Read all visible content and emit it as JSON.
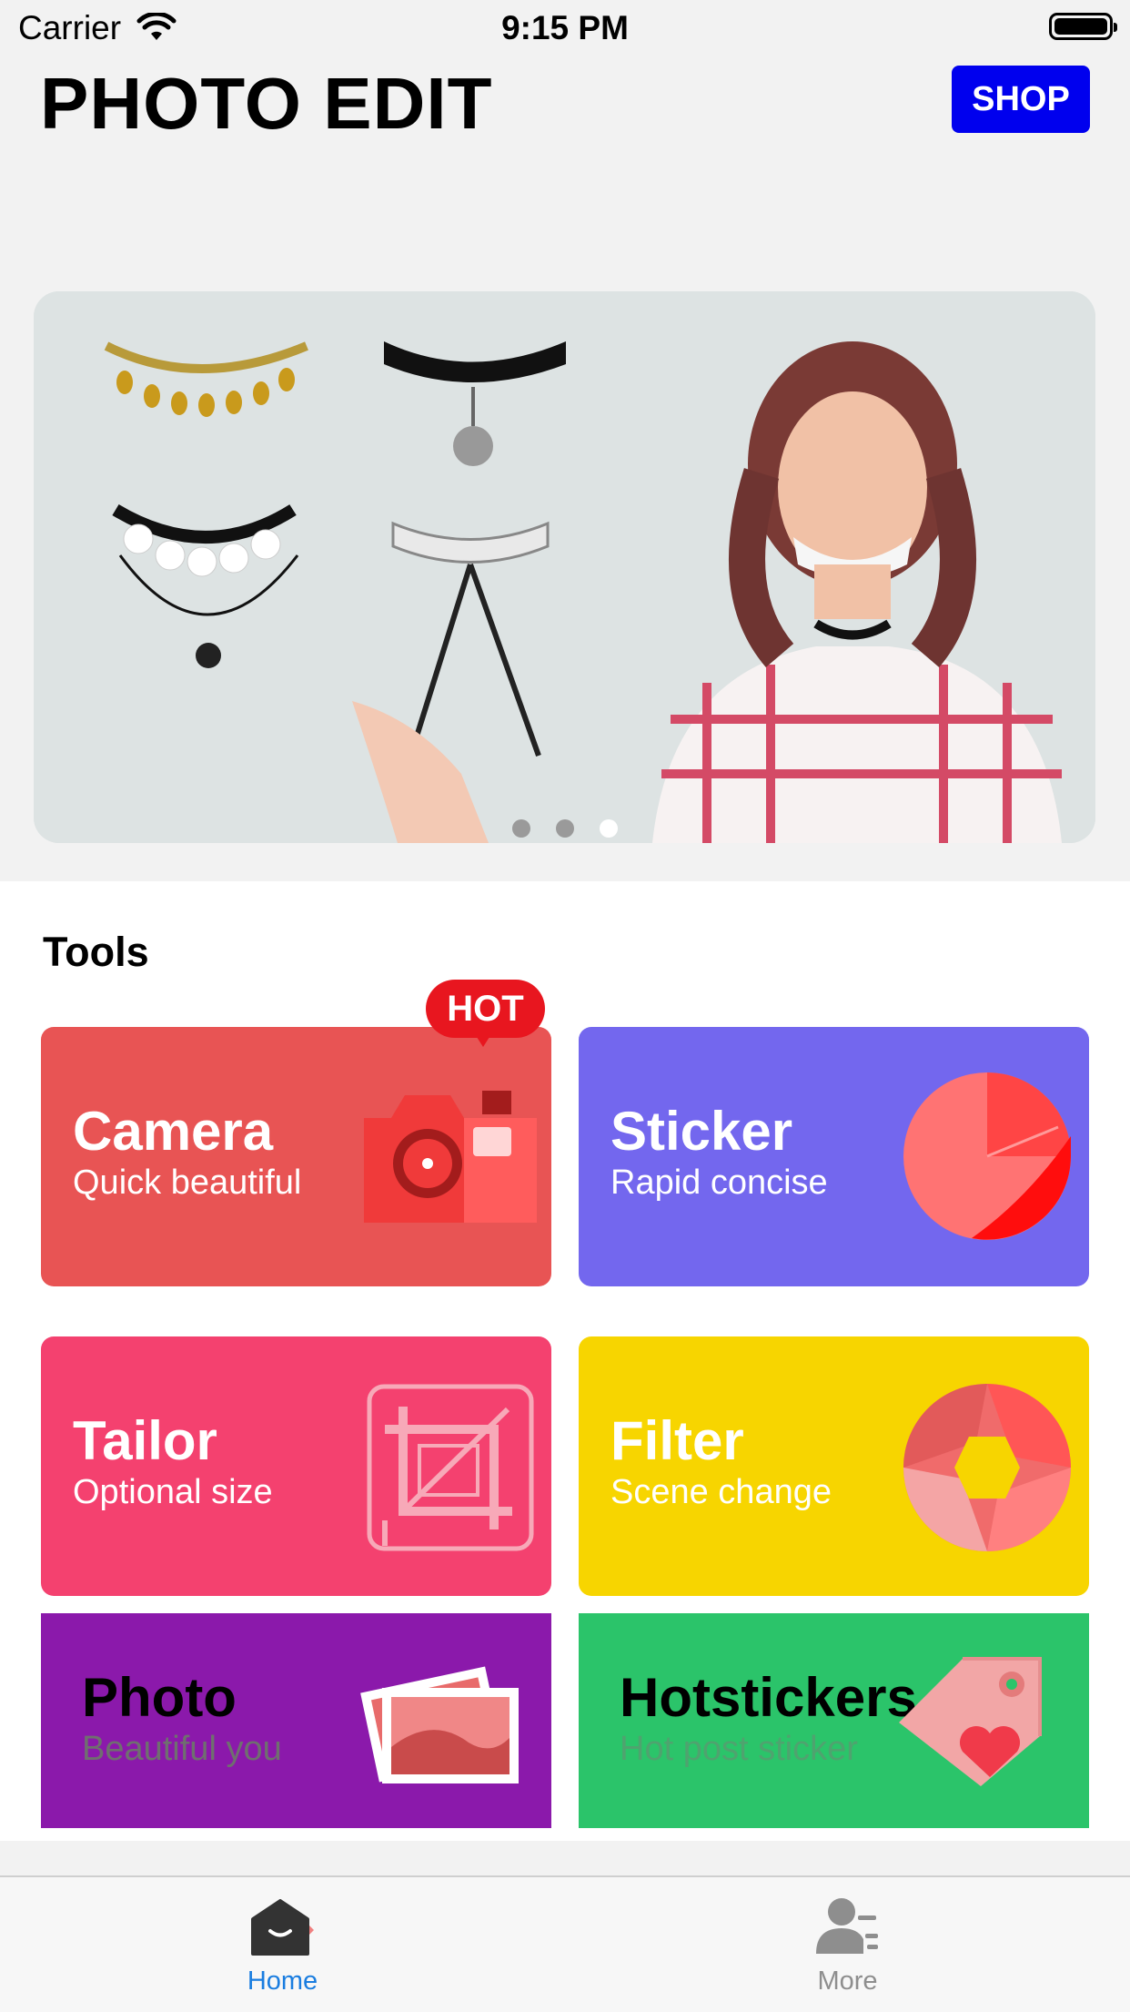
{
  "status_bar": {
    "carrier": "Carrier",
    "time": "9:15 PM"
  },
  "header": {
    "title": "PHOTO EDIT",
    "shop_label": "SHOP"
  },
  "banner": {
    "page_count": 3,
    "current_page": 3
  },
  "tools": {
    "title": "Tools",
    "hot_label": "HOT",
    "cards": [
      {
        "title": "Camera",
        "subtitle": "Quick beautiful",
        "color": "#e85454",
        "icon": "camera-icon"
      },
      {
        "title": "Sticker",
        "subtitle": "Rapid concise",
        "color": "#7367ee",
        "icon": "sticker-pie-icon"
      },
      {
        "title": "Tailor",
        "subtitle": "Optional size",
        "color": "#f4416f",
        "icon": "crop-icon"
      },
      {
        "title": "Filter",
        "subtitle": "Scene change",
        "color": "#f7d500",
        "icon": "aperture-icon"
      },
      {
        "title": "Photo",
        "subtitle": "Beautiful you",
        "color": "#8b19ab",
        "icon": "photos-icon"
      },
      {
        "title": "Hotstickers",
        "subtitle": "Hot post sticker",
        "color": "#2bc46a",
        "icon": "tag-heart-icon"
      }
    ]
  },
  "tab_bar": {
    "items": [
      {
        "label": "Home",
        "selected": true,
        "color": "#1a7de0",
        "icon": "home-icon"
      },
      {
        "label": "More",
        "selected": false,
        "color": "#8e8e8e",
        "icon": "person-list-icon"
      }
    ]
  }
}
